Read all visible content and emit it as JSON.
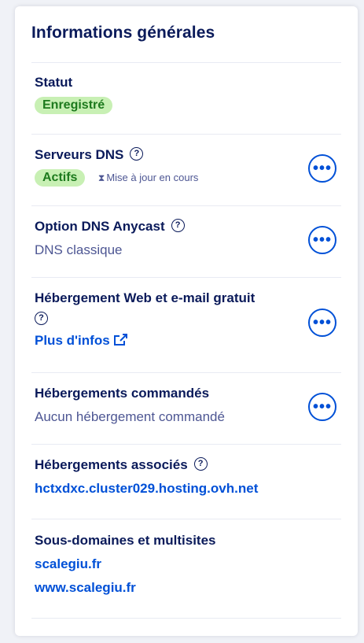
{
  "card": {
    "title": "Informations générales"
  },
  "status": {
    "label": "Statut",
    "badge": "Enregistré"
  },
  "dns_servers": {
    "label": "Serveurs DNS",
    "badge": "Actifs",
    "pending": "Mise à jour en cours",
    "action_icon": "ellipsis-icon"
  },
  "dns_anycast": {
    "label": "Option DNS Anycast",
    "value": "DNS classique",
    "action_icon": "ellipsis-icon"
  },
  "free_hosting": {
    "label": "Hébergement Web et e-mail gratuit",
    "link": "Plus d'infos",
    "action_icon": "ellipsis-icon"
  },
  "ordered_hosting": {
    "label": "Hébergements commandés",
    "value": "Aucun hébergement commandé",
    "action_icon": "ellipsis-icon"
  },
  "associated_hosting": {
    "label": "Hébergements associés",
    "link": "hctxdxc.cluster029.hosting.ovh.net"
  },
  "subdomains": {
    "label": "Sous-domaines et multisites",
    "items": [
      "scalegiu.fr",
      "www.scalegiu.fr"
    ]
  },
  "colors": {
    "title": "#0a1a5a",
    "link": "#0050d7",
    "badge_bg": "#c8f0b4",
    "badge_text": "#1d7a1d",
    "muted": "#4d5693"
  },
  "icons": {
    "help": "question-circle-icon",
    "external": "external-link-icon",
    "hourglass": "hourglass-icon"
  }
}
